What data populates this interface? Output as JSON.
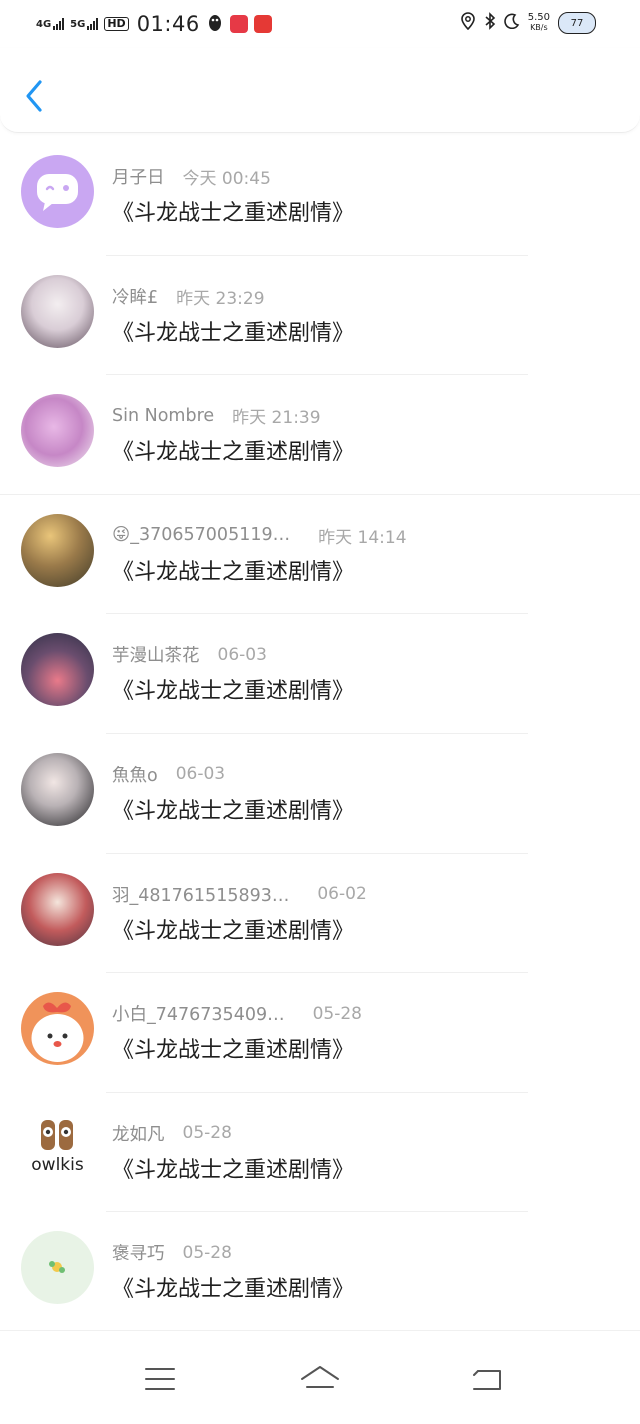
{
  "status_bar": {
    "net1": "4G",
    "net2": "5G",
    "hd": "HD",
    "time": "01:46",
    "speed_value": "5.50",
    "speed_unit": "KB/s",
    "battery": "77"
  },
  "messages": [
    {
      "name": "月子日",
      "time": "今天 00:45",
      "text": "《斗龙战士之重述剧情》"
    },
    {
      "name": "冷眸£",
      "time": "昨天 23:29",
      "text": "《斗龙战士之重述剧情》"
    },
    {
      "name": "Sin Nombre",
      "time": "昨天 21:39",
      "text": "《斗龙战士之重述剧情》"
    },
    {
      "name": "😜_370657005119…",
      "time": "昨天 14:14",
      "text": "《斗龙战士之重述剧情》"
    },
    {
      "name": "芋漫山茶花",
      "time": "06-03",
      "text": "《斗龙战士之重述剧情》"
    },
    {
      "name": "魚魚o",
      "time": "06-03",
      "text": "《斗龙战士之重述剧情》"
    },
    {
      "name": "羽_481761515893…",
      "time": "06-02",
      "text": "《斗龙战士之重述剧情》"
    },
    {
      "name": "小白_7476735409…",
      "time": "05-28",
      "text": "《斗龙战士之重述剧情》"
    },
    {
      "name": "龙如凡",
      "time": "05-28",
      "text": "《斗龙战士之重述剧情》"
    },
    {
      "name": "褒寻巧",
      "time": "05-28",
      "text": "《斗龙战士之重述剧情》"
    }
  ],
  "avatar_logo_text": "owlkis",
  "colors": {
    "accent": "#2196f3",
    "avatar_purple": "#c9a7f2"
  },
  "icons": {
    "back": "chevron-left-icon",
    "nav_menu": "menu-icon",
    "nav_home": "home-icon",
    "nav_back": "return-icon"
  }
}
